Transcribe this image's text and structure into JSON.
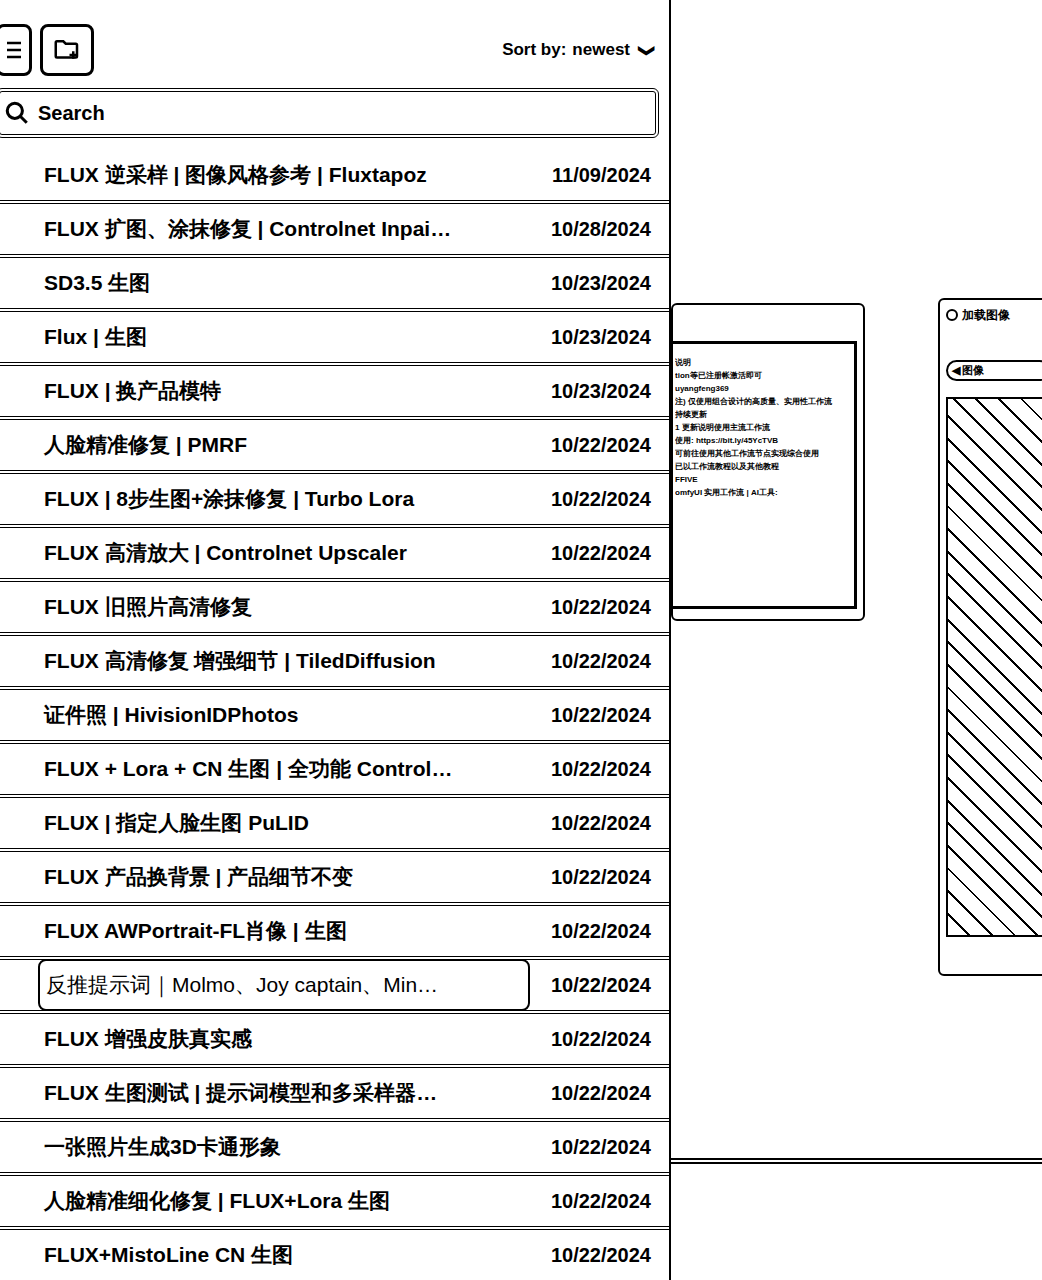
{
  "toolbar": {
    "sort_label": "Sort by:",
    "sort_value": "newest",
    "sort_arrow": "❯"
  },
  "search": {
    "placeholder": "Search"
  },
  "workflows": [
    {
      "title": "FLUX 逆采样 | 图像风格参考 | Fluxtapoz",
      "date": "11/09/2024",
      "selected": false
    },
    {
      "title": "FLUX 扩图、涂抹修复 | Controlnet Inpai…",
      "date": "10/28/2024",
      "selected": false
    },
    {
      "title": "SD3.5 生图",
      "date": "10/23/2024",
      "selected": false
    },
    {
      "title": "Flux | 生图",
      "date": "10/23/2024",
      "selected": false
    },
    {
      "title": "FLUX | 换产品模特",
      "date": "10/23/2024",
      "selected": false
    },
    {
      "title": "人脸精准修复 | PMRF",
      "date": "10/22/2024",
      "selected": false
    },
    {
      "title": "FLUX | 8步生图+涂抹修复 | Turbo Lora",
      "date": "10/22/2024",
      "selected": false
    },
    {
      "title": "FLUX 高清放大 | Controlnet Upscaler",
      "date": "10/22/2024",
      "selected": false
    },
    {
      "title": "FLUX 旧照片高清修复",
      "date": "10/22/2024",
      "selected": false
    },
    {
      "title": "FLUX 高清修复 增强细节 | TiledDiffusion",
      "date": "10/22/2024",
      "selected": false
    },
    {
      "title": "证件照 | HivisionIDPhotos",
      "date": "10/22/2024",
      "selected": false
    },
    {
      "title": "FLUX + Lora + CN 生图 | 全功能 Control…",
      "date": "10/22/2024",
      "selected": false
    },
    {
      "title": "FLUX | 指定人脸生图 PuLID",
      "date": "10/22/2024",
      "selected": false
    },
    {
      "title": "FLUX 产品换背景 | 产品细节不变",
      "date": "10/22/2024",
      "selected": false
    },
    {
      "title": "FLUX AWPortrait-FL肖像 | 生图",
      "date": "10/22/2024",
      "selected": false
    },
    {
      "title": "反推提示词｜Molmo、Joy captain、Min…",
      "date": "10/22/2024",
      "selected": true
    },
    {
      "title": "FLUX 增强皮肤真实感",
      "date": "10/22/2024",
      "selected": false
    },
    {
      "title": "FLUX 生图测试 | 提示词模型和多采样器…",
      "date": "10/22/2024",
      "selected": false
    },
    {
      "title": "一张照片生成3D卡通形象",
      "date": "10/22/2024",
      "selected": false
    },
    {
      "title": "人脸精准细化修复 | FLUX+Lora 生图",
      "date": "10/22/2024",
      "selected": false
    },
    {
      "title": "FLUX+MistoLine CN 生图",
      "date": "10/22/2024",
      "selected": false
    }
  ],
  "canvas": {
    "note_node": {
      "lines": [
        "说明",
        "tion等已注册帐激活即可",
        "uyangfeng369",
        "注) 仅使用组合设计的高质量、实用性工作流",
        "持续更新",
        "1 更新说明使用主流工作流",
        "使用: https://bit.ly/45YcTVB",
        "可前往使用其他工作流节点实现综合使用",
        "已以工作流教程以及其他教程",
        "FFIVE",
        "omfyUI 实用工作流 | AI工具:"
      ]
    },
    "image_node": {
      "title": "加载图像",
      "field_arrow": "◀",
      "field_label": "图像"
    }
  }
}
